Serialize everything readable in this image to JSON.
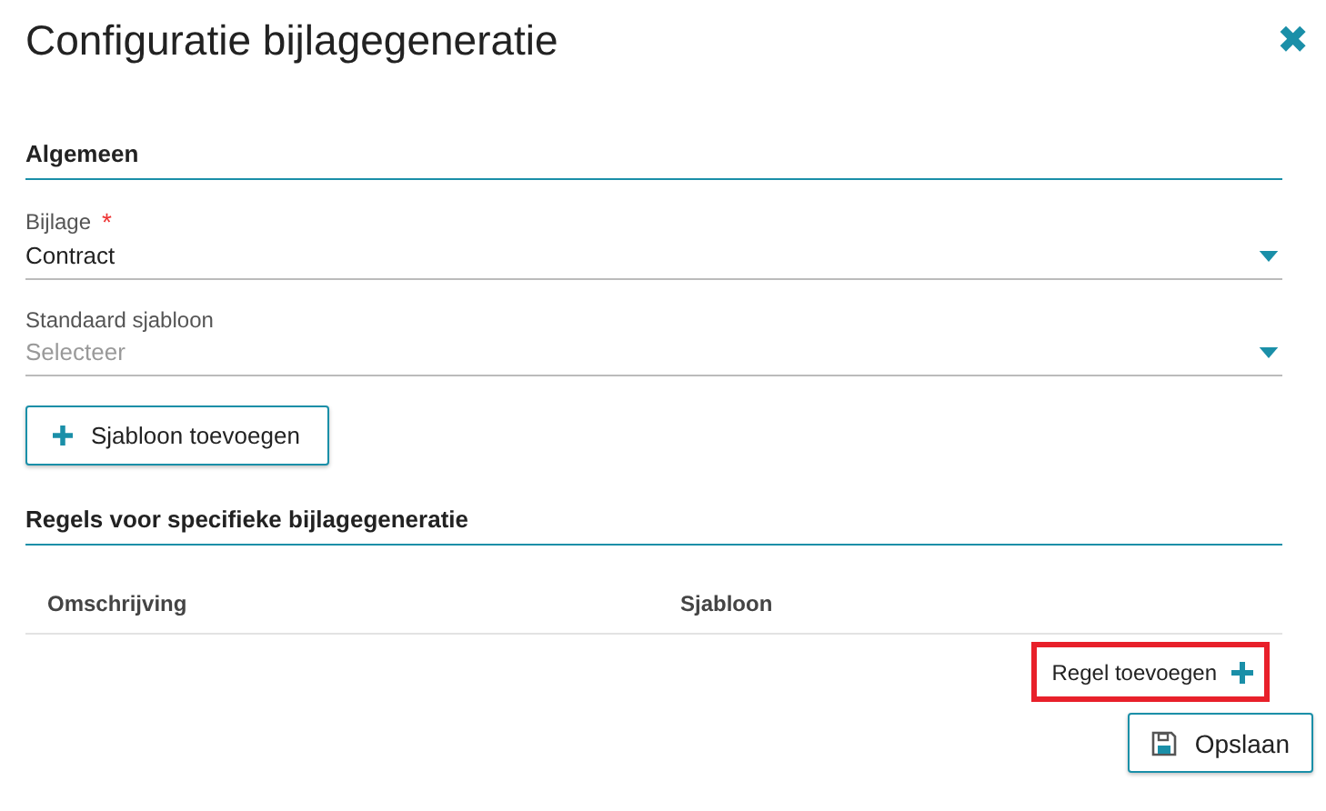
{
  "dialog": {
    "title": "Configuratie bijlagegeneratie",
    "close_icon": "✖"
  },
  "sections": [
    {
      "heading": "Algemeen",
      "fields": [
        {
          "label": "Bijlage",
          "required_mark": "*",
          "value": "Contract"
        },
        {
          "label": "Standaard sjabloon",
          "placeholder": "Selecteer"
        }
      ],
      "button": {
        "label": "Sjabloon toevoegen"
      }
    },
    {
      "heading": "Regels voor specifieke bijlagegeneratie",
      "table": {
        "columns": [
          "Omschrijving",
          "Sjabloon"
        ]
      },
      "add_rule": {
        "label": "Regel toevoegen",
        "highlighted": true
      }
    }
  ],
  "footer": {
    "save_button": "Opslaan"
  }
}
